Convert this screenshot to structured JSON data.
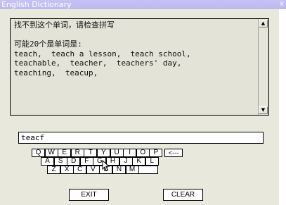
{
  "window": {
    "title": "English Dictionary",
    "close_glyph": "x"
  },
  "output": {
    "lines": [
      "找不到这个单词，请检查拼写",
      "",
      "可能20个是单词是:",
      "teach,  teach a lesson,  teach school,",
      "teachable,  teacher,  teachers' day,",
      "teaching,  teacup,"
    ],
    "scroll_up_glyph": "▲",
    "scroll_down_glyph": "▼"
  },
  "input": {
    "value": "teacf"
  },
  "keyboard": {
    "row1": [
      "Q",
      "W",
      "E",
      "R",
      "T",
      "Y",
      "U",
      "I",
      "O",
      "P"
    ],
    "backspace": "<---",
    "row2": [
      "A",
      "S",
      "D",
      "F",
      "G",
      "H",
      "J",
      "K",
      "L"
    ],
    "row3": [
      "Z",
      "X",
      "C",
      "V",
      "B",
      "N",
      "M",
      ""
    ]
  },
  "buttons": {
    "exit": "EXIT",
    "clear": "CLEAR"
  }
}
